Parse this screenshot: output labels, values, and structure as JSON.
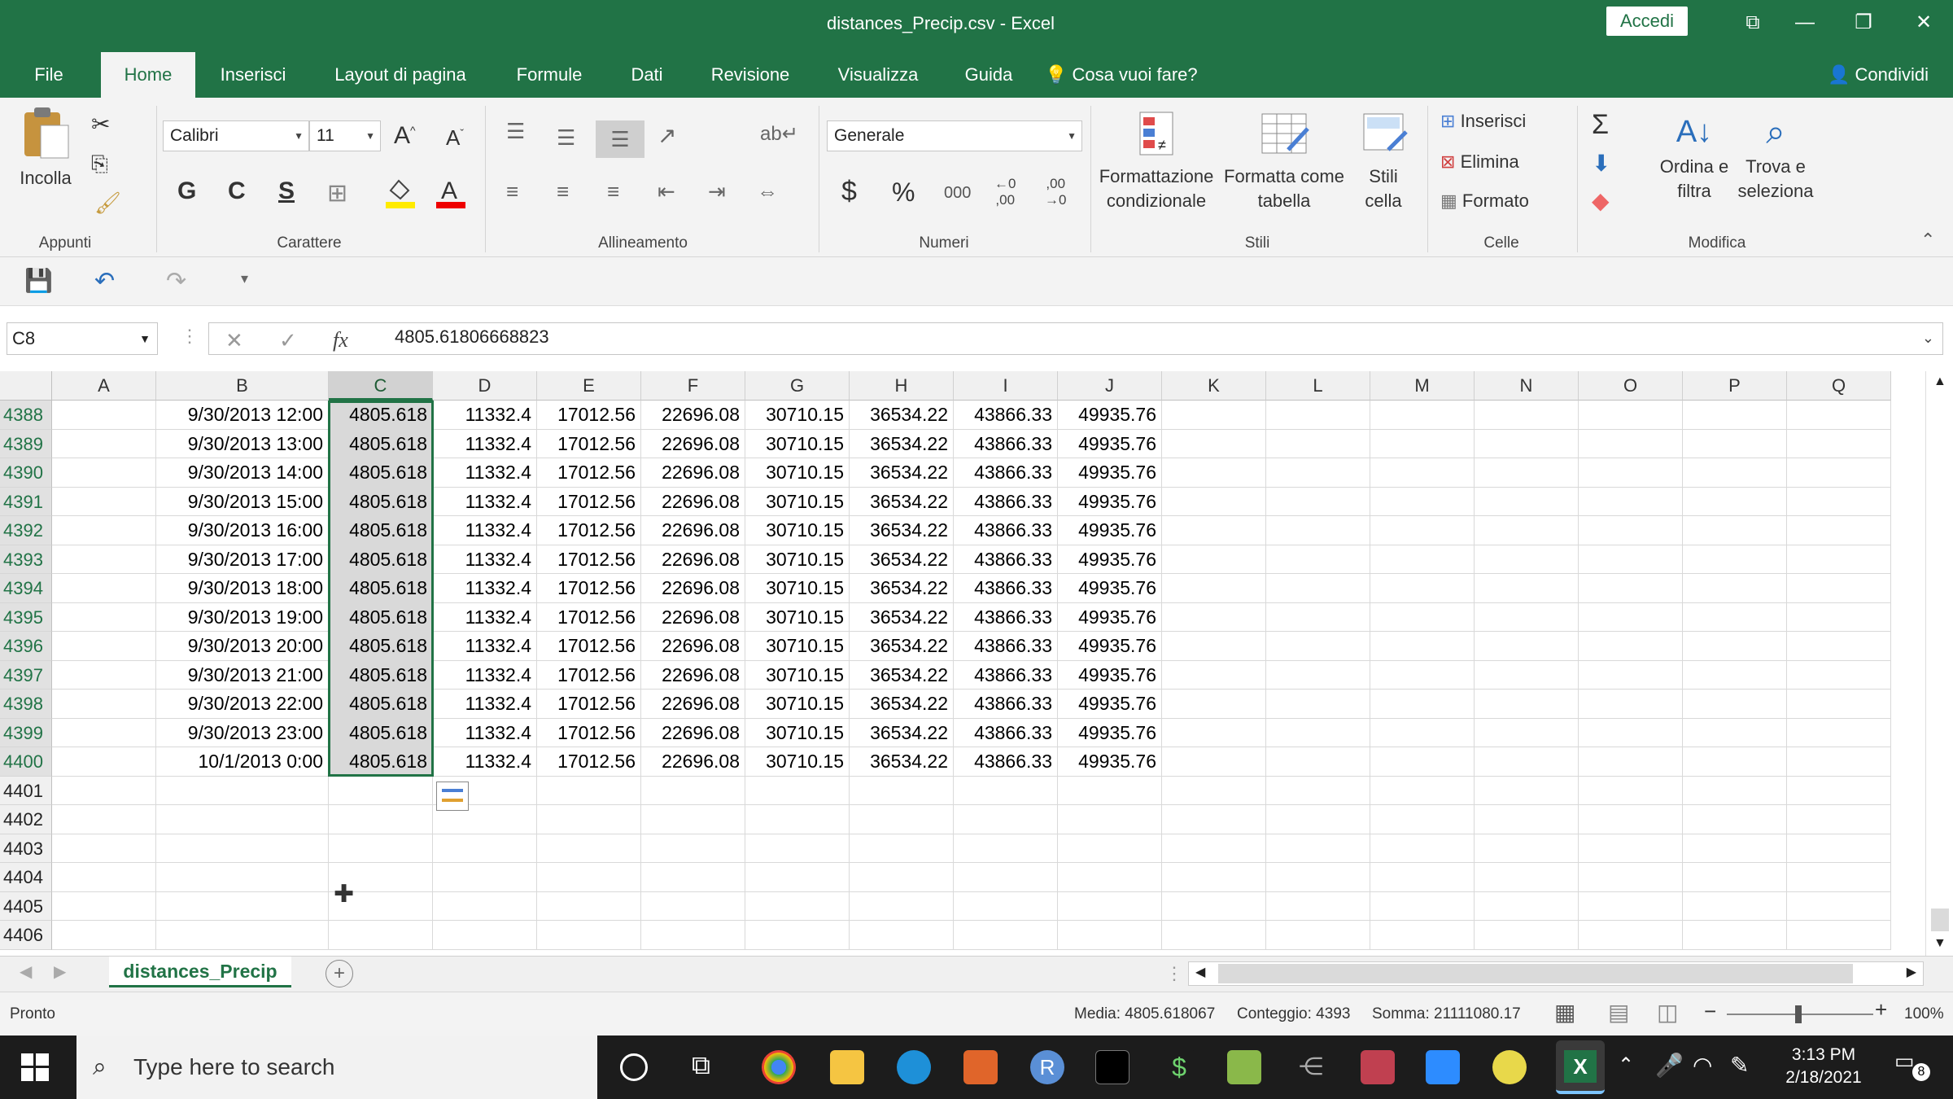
{
  "titlebar": {
    "title": "distances_Precip.csv  -  Excel",
    "signin": "Accedi",
    "restore_glyph": "⧉",
    "minimize_glyph": "—",
    "maximize_glyph": "❐",
    "close_glyph": "✕"
  },
  "tabs": [
    "File",
    "Home",
    "Inserisci",
    "Layout di pagina",
    "Formule",
    "Dati",
    "Revisione",
    "Visualizza",
    "Guida",
    "Cosa vuoi fare?"
  ],
  "share": "Condividi",
  "ribbon": {
    "clipboard": {
      "paste": "Incolla",
      "group": "Appunti"
    },
    "font": {
      "name": "Calibri",
      "size": "11",
      "bold": "G",
      "italic": "C",
      "underline": "S",
      "group": "Carattere"
    },
    "alignment": {
      "group": "Allineamento"
    },
    "number": {
      "format": "Generale",
      "currency": "$",
      "percent": "%",
      "thousands": "000",
      "inc_decimal_top": "←0",
      "inc_decimal_bottom": ",00",
      "dec_decimal_top": ",00",
      "dec_decimal_bottom": "→0",
      "group": "Numeri"
    },
    "styles": {
      "conditional_1": "Formattazione",
      "conditional_2": "condizionale",
      "table_1": "Formatta come",
      "table_2": "tabella",
      "cell_1": "Stili",
      "cell_2": "cella",
      "group": "Stili"
    },
    "cells": {
      "insert": "Inserisci",
      "delete": "Elimina",
      "format": "Formato",
      "group": "Celle"
    },
    "editing": {
      "sort_1": "Ordina e",
      "sort_2": "filtra",
      "find_1": "Trova e",
      "find_2": "seleziona",
      "group": "Modifica"
    }
  },
  "formula_bar": {
    "name_box": "C8",
    "fx": "fx",
    "value": "4805.61806668823"
  },
  "columns": [
    "A",
    "B",
    "C",
    "D",
    "E",
    "F",
    "G",
    "H",
    "I",
    "J",
    "K",
    "L",
    "M",
    "N",
    "O",
    "P",
    "Q"
  ],
  "rows": [
    {
      "n": "4388",
      "B": "9/30/2013 12:00",
      "C": "4805.618",
      "D": "11332.4",
      "E": "17012.56",
      "F": "22696.08",
      "G": "30710.15",
      "H": "36534.22",
      "I": "43866.33",
      "J": "49935.76"
    },
    {
      "n": "4389",
      "B": "9/30/2013 13:00",
      "C": "4805.618",
      "D": "11332.4",
      "E": "17012.56",
      "F": "22696.08",
      "G": "30710.15",
      "H": "36534.22",
      "I": "43866.33",
      "J": "49935.76"
    },
    {
      "n": "4390",
      "B": "9/30/2013 14:00",
      "C": "4805.618",
      "D": "11332.4",
      "E": "17012.56",
      "F": "22696.08",
      "G": "30710.15",
      "H": "36534.22",
      "I": "43866.33",
      "J": "49935.76"
    },
    {
      "n": "4391",
      "B": "9/30/2013 15:00",
      "C": "4805.618",
      "D": "11332.4",
      "E": "17012.56",
      "F": "22696.08",
      "G": "30710.15",
      "H": "36534.22",
      "I": "43866.33",
      "J": "49935.76"
    },
    {
      "n": "4392",
      "B": "9/30/2013 16:00",
      "C": "4805.618",
      "D": "11332.4",
      "E": "17012.56",
      "F": "22696.08",
      "G": "30710.15",
      "H": "36534.22",
      "I": "43866.33",
      "J": "49935.76"
    },
    {
      "n": "4393",
      "B": "9/30/2013 17:00",
      "C": "4805.618",
      "D": "11332.4",
      "E": "17012.56",
      "F": "22696.08",
      "G": "30710.15",
      "H": "36534.22",
      "I": "43866.33",
      "J": "49935.76"
    },
    {
      "n": "4394",
      "B": "9/30/2013 18:00",
      "C": "4805.618",
      "D": "11332.4",
      "E": "17012.56",
      "F": "22696.08",
      "G": "30710.15",
      "H": "36534.22",
      "I": "43866.33",
      "J": "49935.76"
    },
    {
      "n": "4395",
      "B": "9/30/2013 19:00",
      "C": "4805.618",
      "D": "11332.4",
      "E": "17012.56",
      "F": "22696.08",
      "G": "30710.15",
      "H": "36534.22",
      "I": "43866.33",
      "J": "49935.76"
    },
    {
      "n": "4396",
      "B": "9/30/2013 20:00",
      "C": "4805.618",
      "D": "11332.4",
      "E": "17012.56",
      "F": "22696.08",
      "G": "30710.15",
      "H": "36534.22",
      "I": "43866.33",
      "J": "49935.76"
    },
    {
      "n": "4397",
      "B": "9/30/2013 21:00",
      "C": "4805.618",
      "D": "11332.4",
      "E": "17012.56",
      "F": "22696.08",
      "G": "30710.15",
      "H": "36534.22",
      "I": "43866.33",
      "J": "49935.76"
    },
    {
      "n": "4398",
      "B": "9/30/2013 22:00",
      "C": "4805.618",
      "D": "11332.4",
      "E": "17012.56",
      "F": "22696.08",
      "G": "30710.15",
      "H": "36534.22",
      "I": "43866.33",
      "J": "49935.76"
    },
    {
      "n": "4399",
      "B": "9/30/2013 23:00",
      "C": "4805.618",
      "D": "11332.4",
      "E": "17012.56",
      "F": "22696.08",
      "G": "30710.15",
      "H": "36534.22",
      "I": "43866.33",
      "J": "49935.76"
    },
    {
      "n": "4400",
      "B": "10/1/2013 0:00",
      "C": "4805.618",
      "D": "11332.4",
      "E": "17012.56",
      "F": "22696.08",
      "G": "30710.15",
      "H": "36534.22",
      "I": "43866.33",
      "J": "49935.76"
    },
    {
      "n": "4401"
    },
    {
      "n": "4402"
    },
    {
      "n": "4403"
    },
    {
      "n": "4404"
    },
    {
      "n": "4405"
    },
    {
      "n": "4406"
    }
  ],
  "sheet_tab": "distances_Precip",
  "status": {
    "ready": "Pronto",
    "average": "Media: 4805.618067",
    "count": "Conteggio: 4393",
    "sum": "Somma: 21111080.17",
    "zoom": "100%"
  },
  "taskbar": {
    "search_placeholder": "Type here to search",
    "time": "3:13 PM",
    "date": "2/18/2021",
    "notifications": "8"
  },
  "colors": {
    "excel_green": "#217346",
    "selection": "#d9d9d9"
  }
}
